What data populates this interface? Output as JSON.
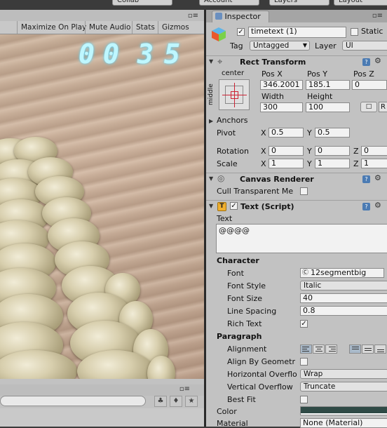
{
  "topbar": {
    "collab_label": "Collab",
    "account_label": "Account",
    "layers_label": "Layers",
    "layout_label": "Layout"
  },
  "game": {
    "toolbar": [
      "Maximize On Play",
      "Mute Audio",
      "Stats",
      "Gizmos"
    ],
    "timer_digits": [
      "0",
      "0",
      "3",
      "5"
    ]
  },
  "project": {
    "search_value": ""
  },
  "inspector": {
    "tab_label": "Inspector",
    "object": {
      "name": "timetext (1)",
      "static_label": "Static",
      "active": true,
      "static": false
    },
    "tag_label": "Tag",
    "tag_value": "Untagged",
    "layer_label": "Layer",
    "layer_value": "UI",
    "rect_transform": {
      "title": "Rect Transform",
      "anchor_preset_top": "center",
      "anchor_preset_side": "middle",
      "posx_label": "Pos X",
      "posy_label": "Pos Y",
      "posz_label": "Pos Z",
      "posx": "346.2001",
      "posy": "185.1",
      "posz": "0",
      "width_label": "Width",
      "height_label": "Height",
      "width": "300",
      "height": "100",
      "r_label": "R",
      "anchors_label": "Anchors",
      "pivot_label": "Pivot",
      "pivot_x": "0.5",
      "pivot_y": "0.5",
      "rotation_label": "Rotation",
      "rot_x": "0",
      "rot_y": "0",
      "rot_z": "0",
      "scale_label": "Scale",
      "scale_x": "1",
      "scale_y": "1",
      "scale_z": "1",
      "x_label": "X",
      "y_label": "Y",
      "z_label": "Z"
    },
    "canvas_renderer": {
      "title": "Canvas Renderer",
      "cull_label": "Cull Transparent Me",
      "cull": false
    },
    "text_script": {
      "title": "Text (Script)",
      "enabled": true,
      "text_label": "Text",
      "text_value": "@@@@",
      "character_label": "Character",
      "font_label": "Font",
      "font_value": "12segmentbig",
      "font_style_label": "Font Style",
      "font_style_value": "Italic",
      "font_size_label": "Font Size",
      "font_size_value": "40",
      "line_spacing_label": "Line Spacing",
      "line_spacing_value": "0.8",
      "rich_text_label": "Rich Text",
      "rich_text": true,
      "paragraph_label": "Paragraph",
      "alignment_label": "Alignment",
      "align_by_geometry_label": "Align By Geometr",
      "align_by_geometry": false,
      "horizontal_overflow_label": "Horizontal Overflo",
      "horizontal_overflow_value": "Wrap",
      "vertical_overflow_label": "Vertical Overflow",
      "vertical_overflow_value": "Truncate",
      "best_fit_label": "Best Fit",
      "best_fit": false,
      "color_label": "Color",
      "color_value": "#2f4a46",
      "material_label": "Material",
      "material_value": "None (Material)"
    }
  },
  "colors": {
    "accent_blue": "#4b7bb3",
    "timer_glow": "#bff7ff",
    "text_color_swatch": "#2f4a46"
  }
}
